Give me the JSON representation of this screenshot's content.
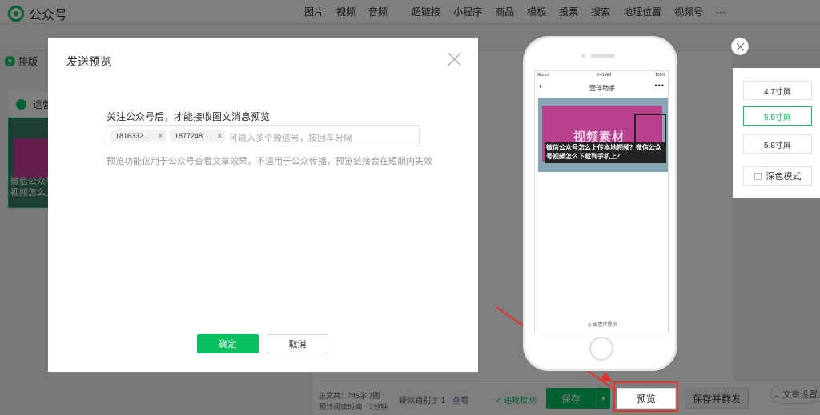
{
  "brand": {
    "name": "公众号"
  },
  "topmenu": [
    "图片",
    "视频",
    "音频",
    "超链接",
    "小程序",
    "商品",
    "模板",
    "投票",
    "搜索",
    "地理位置",
    "视频号",
    "···"
  ],
  "leftnav": {
    "layout_tab": "排版",
    "card_title": "运营",
    "card_caption": "微信公众号视频怎么上"
  },
  "bottombar": {
    "word_count_label": "正文共：",
    "word_count_value": "745字 7图",
    "read_time_label": "预计阅读时间：",
    "read_time_value": "2分钟",
    "suspect_label": "疑似错别字 1",
    "view": "查看",
    "compliance": "违规检测",
    "save": "保存",
    "preview": "预览",
    "save_publish": "保存并群发",
    "settings": "文章设置"
  },
  "modal": {
    "title": "发送预览",
    "field_label": "关注公众号后，才能接收图文消息预览",
    "chips": [
      "1816332...",
      "1877248..."
    ],
    "input_placeholder": "可输入多个微信号，按回车分隔",
    "hint": "预览功能仅用于公众号查看文章效果，不适用于公众传播，预览链接会在短期内失效",
    "confirm": "确定",
    "cancel": "取消"
  },
  "phone": {
    "carrier": "Sketch",
    "time": "9:41 AM",
    "battery": "100%",
    "nav_title": "壹伴助手",
    "image_title": "视频素材",
    "image_caption": "微信公众号怎么上传本地视频？微信公众号视频怎么下载到手机上？",
    "provider": "由壹伴提供"
  },
  "size_panel": {
    "options": [
      "4.7寸屏",
      "5.5寸屏",
      "5.8寸屏"
    ],
    "selected": "5.5寸屏",
    "dark_mode": "深色模式"
  },
  "colors": {
    "accent": "#07c160",
    "annotation": "#e5322d"
  }
}
